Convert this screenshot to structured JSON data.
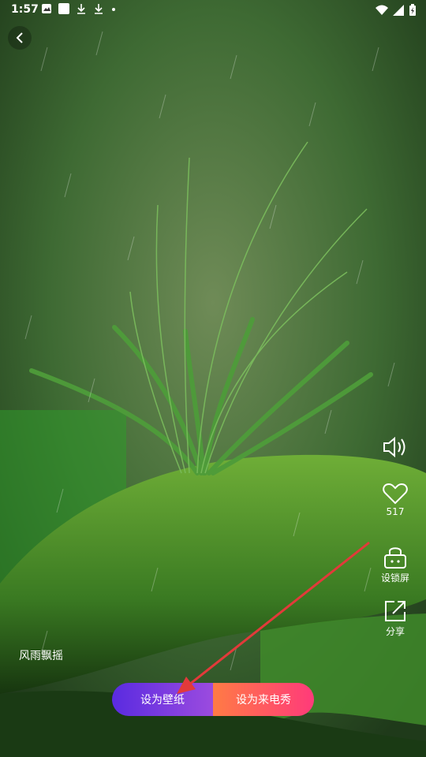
{
  "status_bar": {
    "time": "1:57"
  },
  "wallpaper": {
    "title": "风雨飘摇",
    "likes": "517"
  },
  "side_actions": {
    "lock_label": "设锁屏",
    "share_label": "分享"
  },
  "buttons": {
    "set_wallpaper": "设为壁纸",
    "set_call_show": "设为来电秀"
  },
  "colors": {
    "primary_gradient_start": "#5a2be0",
    "primary_gradient_end": "#9b4bdf",
    "secondary_gradient_start": "#ff7b45",
    "secondary_gradient_end": "#ff3a7a",
    "annotation_arrow": "#e23a3a"
  }
}
